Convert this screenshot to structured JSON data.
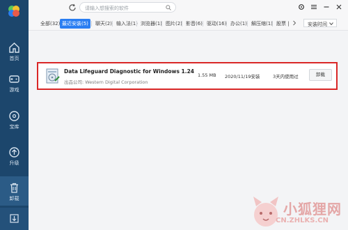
{
  "sidebar": {
    "items": [
      {
        "label": "首页",
        "icon": "home-icon"
      },
      {
        "label": "游戏",
        "icon": "gamepad-icon"
      },
      {
        "label": "宝库",
        "icon": "disc-icon"
      },
      {
        "label": "升级",
        "icon": "upgrade-icon"
      },
      {
        "label": "卸载",
        "icon": "trash-icon"
      }
    ],
    "active": "卸载"
  },
  "search": {
    "placeholder": "请输入想搜索的软件"
  },
  "tabs": [
    {
      "label": "全部(32)"
    },
    {
      "label": "最近安装(5)",
      "active": true
    },
    {
      "label": "聊天(2)"
    },
    {
      "label": "输入法(1)"
    },
    {
      "label": "浏览器(1)"
    },
    {
      "label": "图片(2)"
    },
    {
      "label": "影音(6)"
    },
    {
      "label": "驱动(16)"
    },
    {
      "label": "办公(1)"
    },
    {
      "label": "解压缩(1)"
    },
    {
      "label": "股票 |"
    }
  ],
  "sort": {
    "label": "安装时间"
  },
  "app": {
    "name": "Data Lifeguard Diagnostic for Windows 1.24",
    "publisher": "出品公司: Western Digital Corporation",
    "size": "1.55 MB",
    "installed": "2020/11/19安装",
    "usage": "3天内使用过",
    "uninstall_label": "卸载"
  },
  "watermark": {
    "title": "小狐狸网",
    "url": "CN.ZHLKS.CN"
  },
  "colors": {
    "sidebar": "#1c466c",
    "accent": "#2a7ef2",
    "highlight_border": "#d92626"
  }
}
